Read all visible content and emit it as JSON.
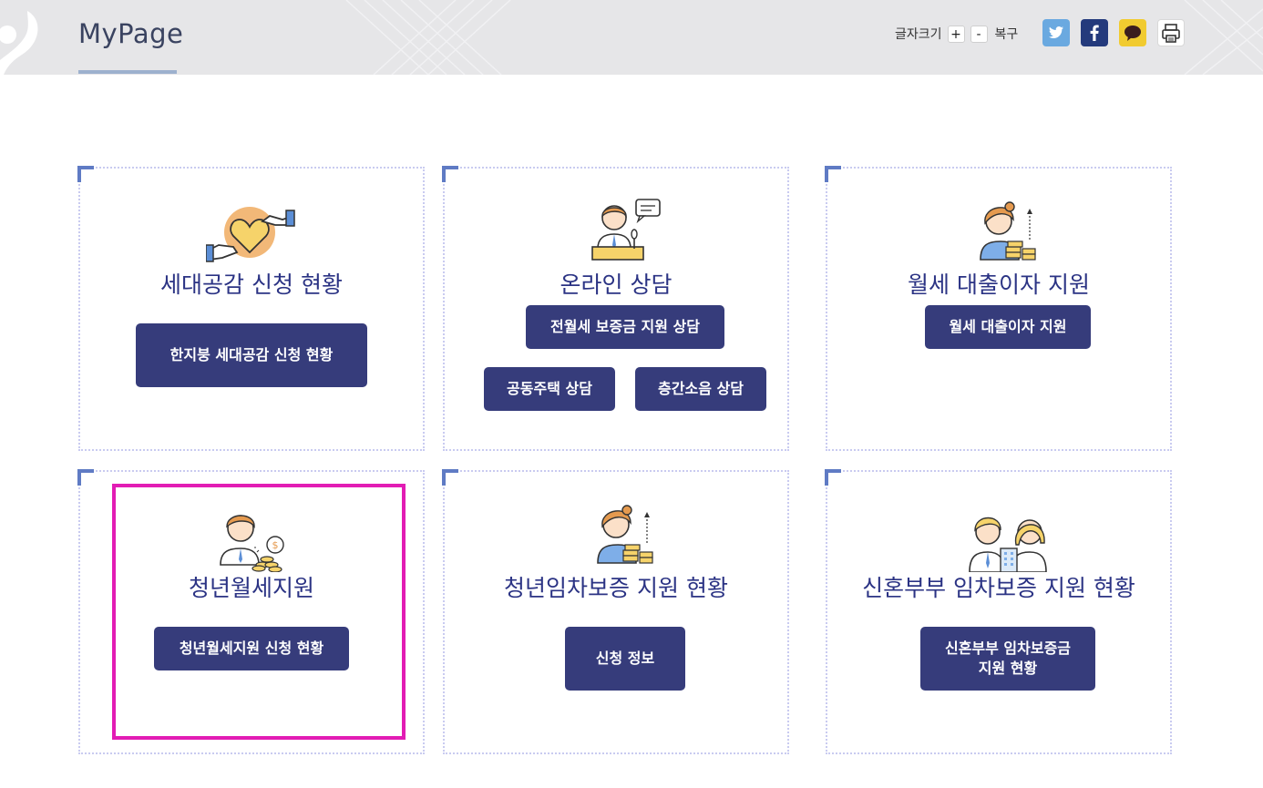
{
  "header": {
    "title": "MyPage",
    "font_size_label": "글자크기",
    "font_plus": "+",
    "font_minus": "-",
    "font_restore": "복구",
    "share_icons": [
      "twitter-icon",
      "facebook-icon",
      "kakaotalk-icon",
      "print-icon"
    ]
  },
  "cards": [
    {
      "title": "세대공감 신청 현황",
      "icon": "heart-handshake-icon",
      "buttons": [
        "한지붕 세대공감 신청 현황"
      ]
    },
    {
      "title": "온라인 상담",
      "icon": "consultant-icon",
      "buttons": [
        "전월세 보증금 지원 상담",
        "공동주택 상담",
        "층간소음 상담"
      ]
    },
    {
      "title": "월세 대출이자 지원",
      "icon": "woman-coins-icon",
      "buttons": [
        "월세 대출이자 지원"
      ]
    },
    {
      "title": "청년월세지원",
      "icon": "man-coins-icon",
      "buttons": [
        "청년월세지원 신청 현황"
      ]
    },
    {
      "title": "청년임차보증 지원 현황",
      "icon": "woman-coins-icon",
      "buttons": [
        "신청 정보"
      ]
    },
    {
      "title": "신혼부부 임차보증 지원 현황",
      "icon": "couple-icon",
      "buttons": [
        "신혼부부 임차보증금\n지원 현황"
      ]
    }
  ],
  "colors": {
    "header_bg": "#e6e6e8",
    "title_text": "#2b3384",
    "button_bg": "#363c7b",
    "corner_accent": "#5f7bc4",
    "highlight": "#e21cb4"
  }
}
